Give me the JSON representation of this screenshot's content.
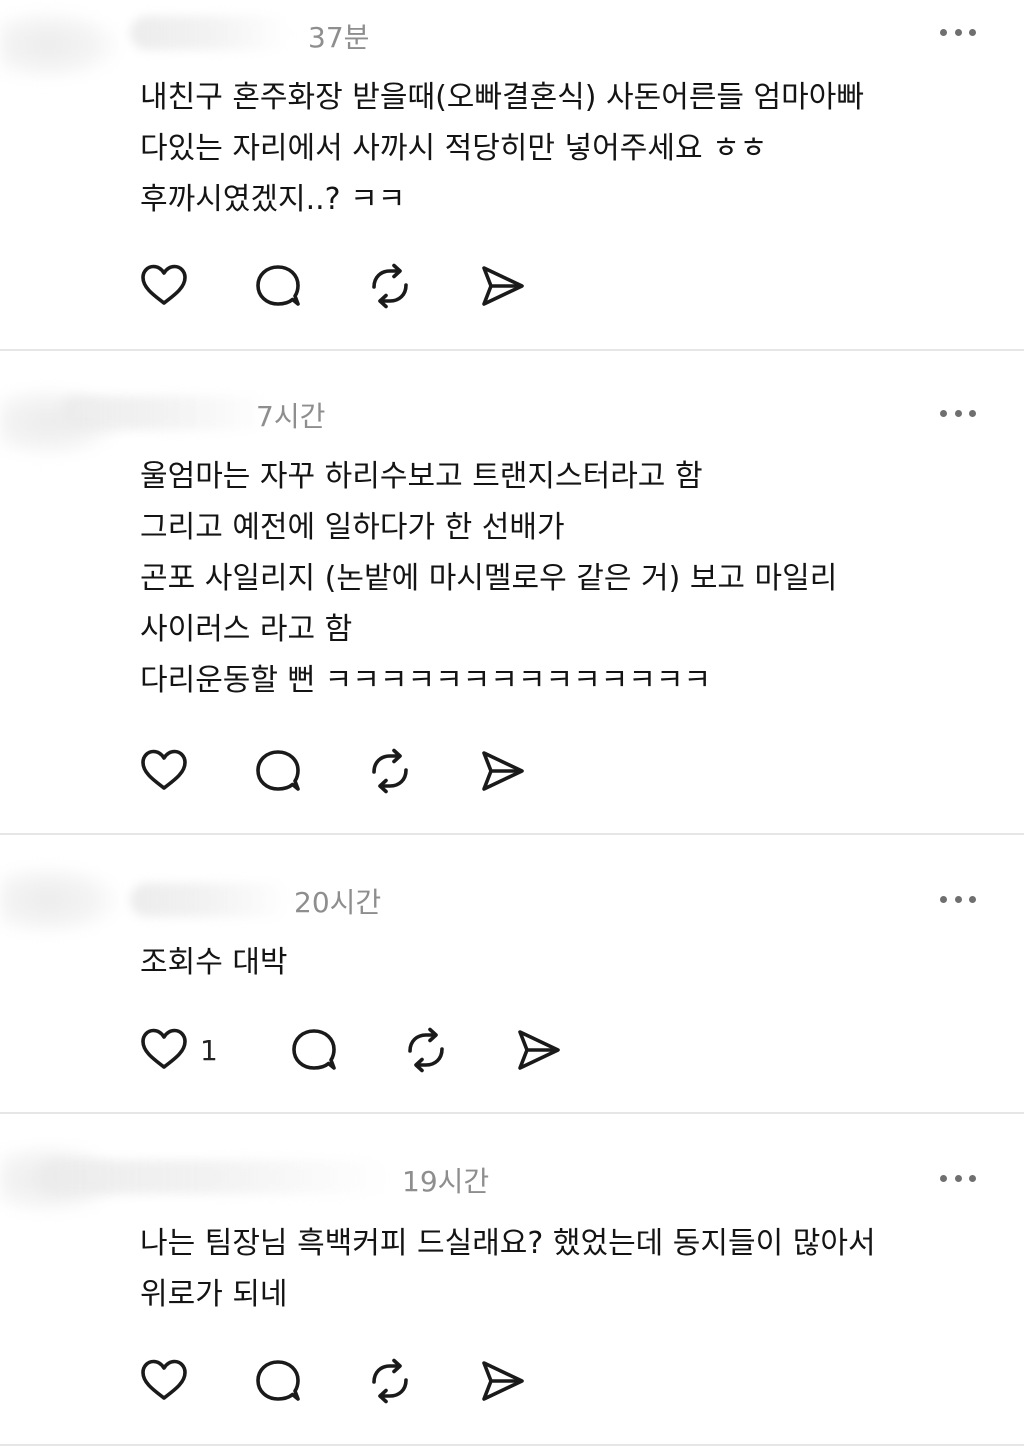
{
  "posts": [
    {
      "time": "37분",
      "lines": [
        "내친구 혼주화장 받을때(오빠결혼식) 사돈어른들 엄마아빠",
        "다있는 자리에서  사까시 적당히만 넣어주세요 ㅎㅎ",
        "후까시였겠지..? ㅋㅋ"
      ],
      "like_count": ""
    },
    {
      "time": "7시간",
      "lines": [
        "울엄마는 자꾸 하리수보고 트랜지스터라고 함",
        "그리고 예전에 일하다가 한 선배가",
        "곤포 사일리지 (논밭에 마시멜로우 같은 거) 보고 마일리",
        "사이러스 라고 함",
        "다리운동할 뻔 ㅋㅋㅋㅋㅋㅋㅋㅋㅋㅋㅋㅋㅋㅋ"
      ],
      "like_count": ""
    },
    {
      "time": "20시간",
      "lines": [
        "조회수 대박"
      ],
      "like_count": "1"
    },
    {
      "time": "19시간",
      "lines": [
        "나는 팀장님 흑백커피 드실래요? 했었는데 동지들이 많아서",
        "위로가 되네"
      ],
      "like_count": ""
    }
  ],
  "icons": {
    "like": "heart-icon",
    "reply": "comment-bubble-icon",
    "repost": "repost-icon",
    "share": "send-icon",
    "more": "more-horizontal-icon"
  },
  "colors": {
    "text": "#141414",
    "meta": "#8e8e8e",
    "icon": "#1a1a1a",
    "divider": "#e6e6e6"
  }
}
